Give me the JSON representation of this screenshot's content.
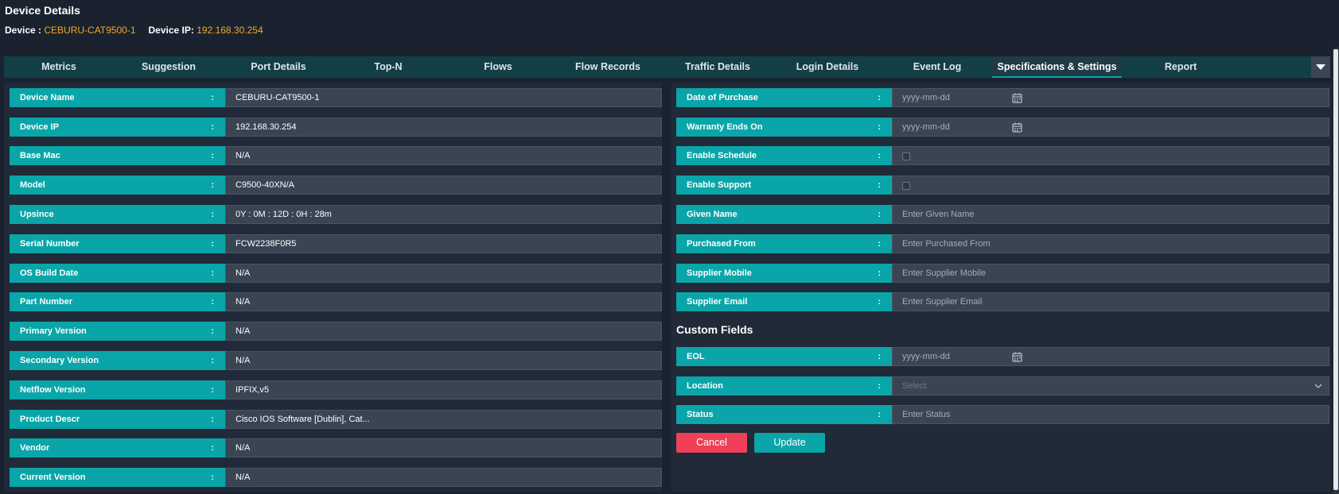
{
  "header": {
    "title": "Device Details",
    "device_label": "Device : ",
    "device_value": "CEBURU-CAT9500-1",
    "ip_label": "Device IP: ",
    "ip_value": "192.168.30.254"
  },
  "tabs": [
    {
      "label": "Metrics"
    },
    {
      "label": "Suggestion"
    },
    {
      "label": "Port Details"
    },
    {
      "label": "Top-N"
    },
    {
      "label": "Flows"
    },
    {
      "label": "Flow Records"
    },
    {
      "label": "Traffic Details"
    },
    {
      "label": "Login Details"
    },
    {
      "label": "Event Log"
    },
    {
      "label": "Specifications & Settings",
      "active": true
    },
    {
      "label": "Report"
    }
  ],
  "more_tabs_icon": "caret-down-icon",
  "left_fields": [
    {
      "label": "Device Name",
      "value": "CEBURU-CAT9500-1"
    },
    {
      "label": "Device IP",
      "value": "192.168.30.254"
    },
    {
      "label": "Base Mac",
      "value": "N/A"
    },
    {
      "label": "Model",
      "value": "C9500-40XN/A"
    },
    {
      "label": "Upsince",
      "value": "0Y : 0M : 12D : 0H : 28m"
    },
    {
      "label": "Serial Number",
      "value": "FCW2238F0R5"
    },
    {
      "label": "OS Build Date",
      "value": "N/A"
    },
    {
      "label": "Part Number",
      "value": "N/A"
    },
    {
      "label": "Primary Version",
      "value": "N/A"
    },
    {
      "label": "Secondary Version",
      "value": "N/A"
    },
    {
      "label": "Netflow Version",
      "value": "IPFIX,v5"
    },
    {
      "label": "Product Descr",
      "value": "Cisco IOS Software [Dublin], Cat..."
    },
    {
      "label": "Vendor",
      "value": "N/A"
    },
    {
      "label": "Current Version",
      "value": "N/A"
    }
  ],
  "right_fields": [
    {
      "label": "Date of Purchase",
      "placeholder": "yyyy-mm-dd",
      "kind": "date"
    },
    {
      "label": "Warranty Ends On",
      "placeholder": "yyyy-mm-dd",
      "kind": "date"
    },
    {
      "label": "Enable Schedule",
      "kind": "checkbox",
      "checked": false
    },
    {
      "label": "Enable Support",
      "kind": "checkbox",
      "checked": false
    },
    {
      "label": "Given Name",
      "placeholder": "Enter Given Name",
      "kind": "text"
    },
    {
      "label": "Purchased From",
      "placeholder": "Enter Purchased From",
      "kind": "text"
    },
    {
      "label": "Supplier Mobile",
      "placeholder": "Enter Supplier Mobile",
      "kind": "text"
    },
    {
      "label": "Supplier Email",
      "placeholder": "Enter Supplier Email",
      "kind": "text"
    }
  ],
  "custom_fields_title": "Custom Fields",
  "custom_fields": [
    {
      "label": "EOL",
      "placeholder": "yyyy-mm-dd",
      "kind": "date"
    },
    {
      "label": "Location",
      "placeholder": "Select",
      "kind": "select"
    },
    {
      "label": "Status",
      "placeholder": "Enter Status",
      "kind": "text"
    }
  ],
  "buttons": {
    "cancel": "Cancel",
    "update": "Update"
  },
  "colors": {
    "background": "#1a2230",
    "panel": "#202a38",
    "accent_teal": "#0aa5a8",
    "tab_bar": "#123f45",
    "highlight_orange": "#f5a623",
    "cancel_red": "#ef4058"
  }
}
